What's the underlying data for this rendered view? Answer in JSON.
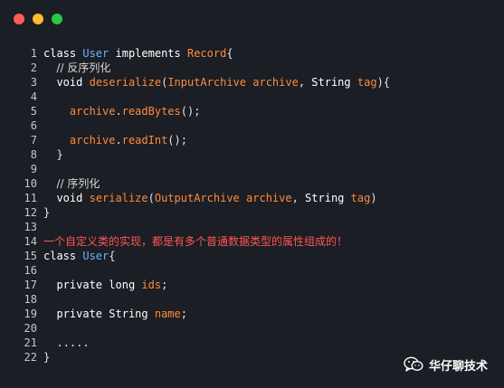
{
  "window": {
    "controls": [
      "close",
      "minimize",
      "maximize"
    ],
    "colors": {
      "close": "#fe5f57",
      "minimize": "#febc2e",
      "maximize": "#28c840",
      "background": "#1b1e24"
    }
  },
  "code": {
    "lines": [
      {
        "n": "1",
        "tokens": [
          [
            "kw",
            "class"
          ],
          [
            "pl",
            " "
          ],
          [
            "cls",
            "User"
          ],
          [
            "pl",
            " "
          ],
          [
            "kw",
            "implements"
          ],
          [
            "pl",
            " "
          ],
          [
            "id",
            "Record"
          ],
          [
            "pl",
            "{"
          ]
        ]
      },
      {
        "n": "2",
        "tokens": [
          [
            "pl",
            "  "
          ],
          [
            "cm",
            "// 反序列化"
          ]
        ]
      },
      {
        "n": "3",
        "tokens": [
          [
            "pl",
            "  "
          ],
          [
            "kw",
            "void"
          ],
          [
            "pl",
            " "
          ],
          [
            "fn",
            "deserialize"
          ],
          [
            "pl",
            "("
          ],
          [
            "id",
            "InputArchive"
          ],
          [
            "pl",
            " "
          ],
          [
            "id",
            "archive"
          ],
          [
            "pl",
            ", "
          ],
          [
            "str",
            "String"
          ],
          [
            "pl",
            " "
          ],
          [
            "id",
            "tag"
          ],
          [
            "pl",
            "){"
          ]
        ]
      },
      {
        "n": "4",
        "tokens": []
      },
      {
        "n": "5",
        "tokens": [
          [
            "pl",
            "    "
          ],
          [
            "id",
            "archive"
          ],
          [
            "pl",
            "."
          ],
          [
            "fn",
            "readBytes"
          ],
          [
            "pl",
            "();"
          ]
        ]
      },
      {
        "n": "6",
        "tokens": []
      },
      {
        "n": "7",
        "tokens": [
          [
            "pl",
            "    "
          ],
          [
            "id",
            "archive"
          ],
          [
            "pl",
            "."
          ],
          [
            "fn",
            "readInt"
          ],
          [
            "pl",
            "();"
          ]
        ]
      },
      {
        "n": "8",
        "tokens": [
          [
            "pl",
            "  }"
          ]
        ]
      },
      {
        "n": "9",
        "tokens": []
      },
      {
        "n": "10",
        "tokens": [
          [
            "pl",
            "  "
          ],
          [
            "cm",
            "// 序列化"
          ]
        ]
      },
      {
        "n": "11",
        "tokens": [
          [
            "pl",
            "  "
          ],
          [
            "kw",
            "void"
          ],
          [
            "pl",
            " "
          ],
          [
            "fn",
            "serialize"
          ],
          [
            "pl",
            "("
          ],
          [
            "id",
            "OutputArchive"
          ],
          [
            "pl",
            " "
          ],
          [
            "id",
            "archive"
          ],
          [
            "pl",
            ", "
          ],
          [
            "str",
            "String"
          ],
          [
            "pl",
            " "
          ],
          [
            "id",
            "tag"
          ],
          [
            "pl",
            ")"
          ]
        ]
      },
      {
        "n": "12",
        "tokens": [
          [
            "pl",
            "}"
          ]
        ]
      },
      {
        "n": "13",
        "tokens": []
      },
      {
        "n": "14",
        "tokens": [
          [
            "red",
            "一个自定义类的实现，都是有多个普通数据类型的属性组成的！"
          ]
        ]
      },
      {
        "n": "15",
        "tokens": [
          [
            "kw",
            "class"
          ],
          [
            "pl",
            " "
          ],
          [
            "cls",
            "User"
          ],
          [
            "pl",
            "{"
          ]
        ]
      },
      {
        "n": "16",
        "tokens": []
      },
      {
        "n": "17",
        "tokens": [
          [
            "pl",
            "  "
          ],
          [
            "kw",
            "private"
          ],
          [
            "pl",
            " "
          ],
          [
            "kw",
            "long"
          ],
          [
            "pl",
            " "
          ],
          [
            "id",
            "ids"
          ],
          [
            "pl",
            ";"
          ]
        ]
      },
      {
        "n": "18",
        "tokens": []
      },
      {
        "n": "19",
        "tokens": [
          [
            "pl",
            "  "
          ],
          [
            "kw",
            "private"
          ],
          [
            "pl",
            " "
          ],
          [
            "str",
            "String"
          ],
          [
            "pl",
            " "
          ],
          [
            "id",
            "name"
          ],
          [
            "pl",
            ";"
          ]
        ]
      },
      {
        "n": "20",
        "tokens": []
      },
      {
        "n": "21",
        "tokens": [
          [
            "pl",
            "  ....."
          ]
        ]
      },
      {
        "n": "22",
        "tokens": [
          [
            "pl",
            "}"
          ]
        ]
      }
    ]
  },
  "watermark": {
    "icon": "wechat-icon",
    "text": "华仔聊技术"
  }
}
